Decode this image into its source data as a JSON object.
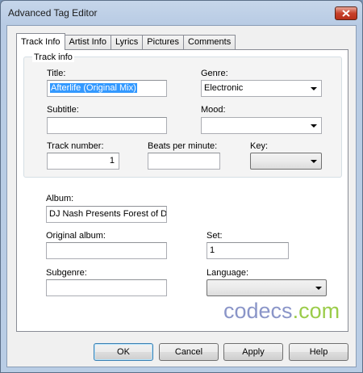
{
  "window": {
    "title": "Advanced Tag Editor"
  },
  "tabs": [
    {
      "label": "Track Info"
    },
    {
      "label": "Artist Info"
    },
    {
      "label": "Lyrics"
    },
    {
      "label": "Pictures"
    },
    {
      "label": "Comments"
    }
  ],
  "track_info": {
    "group_title": "Track info",
    "title_label": "Title:",
    "title_value": "Afterlife (Original Mix)",
    "genre_label": "Genre:",
    "genre_value": "Electronic",
    "subtitle_label": "Subtitle:",
    "subtitle_value": "",
    "mood_label": "Mood:",
    "mood_value": "",
    "track_number_label": "Track number:",
    "track_number_value": "1",
    "bpm_label": "Beats per minute:",
    "bpm_value": "",
    "key_label": "Key:",
    "key_value": ""
  },
  "album_info": {
    "album_label": "Album:",
    "album_value": "DJ Nash Presents Forest of Dre",
    "original_album_label": "Original album:",
    "original_album_value": "",
    "set_label": "Set:",
    "set_value": "1",
    "subgenre_label": "Subgenre:",
    "subgenre_value": "",
    "language_label": "Language:",
    "language_value": ""
  },
  "watermark": {
    "left": "codecs",
    "dot": ".",
    "right": "com"
  },
  "buttons": {
    "ok": "OK",
    "cancel": "Cancel",
    "apply": "Apply",
    "help": "Help"
  }
}
